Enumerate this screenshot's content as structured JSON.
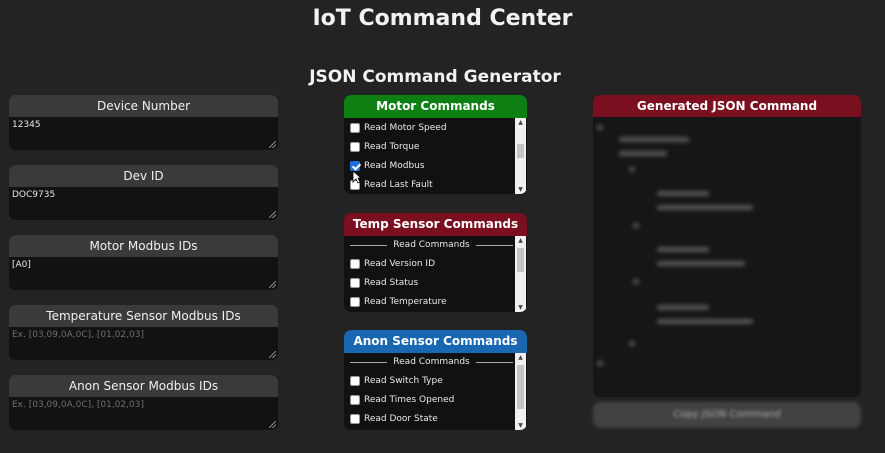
{
  "app": {
    "title": "IoT Command Center",
    "section_title": "JSON Command Generator"
  },
  "fields": [
    {
      "label": "Device Number",
      "value": "12345",
      "placeholder": ""
    },
    {
      "label": "Dev ID",
      "value": "DOC9735",
      "placeholder": ""
    },
    {
      "label": "Motor Modbus IDs",
      "value": "[A0]",
      "placeholder": ""
    },
    {
      "label": "Temperature Sensor Modbus IDs",
      "value": "",
      "placeholder": "Ex. [03,09,0A,0C], [01,02,03]"
    },
    {
      "label": "Anon Sensor Modbus IDs",
      "value": "",
      "placeholder": "Ex. [03,09,0A,0C], [01,02,03]"
    }
  ],
  "panels": {
    "motor": {
      "title": "Motor Commands",
      "color": "#0e7f12",
      "items": [
        {
          "label": "Read Motor Speed",
          "checked": false
        },
        {
          "label": "Read Torque",
          "checked": false
        },
        {
          "label": "Read Modbus",
          "checked": true
        },
        {
          "label": "Read Last Fault",
          "checked": false
        }
      ]
    },
    "temp": {
      "title": "Temp Sensor Commands",
      "color": "#7a0f1f",
      "group": "Read Commands",
      "items": [
        {
          "label": "Read Version ID",
          "checked": false
        },
        {
          "label": "Read Status",
          "checked": false
        },
        {
          "label": "Read Temperature",
          "checked": false
        }
      ]
    },
    "anon": {
      "title": "Anon Sensor Commands",
      "color": "#1867b0",
      "group": "Read Commands",
      "items": [
        {
          "label": "Read Switch Type",
          "checked": false
        },
        {
          "label": "Read Times Opened",
          "checked": false
        },
        {
          "label": "Read Door State",
          "checked": false
        }
      ]
    }
  },
  "json_output": {
    "title": "Generated JSON Command",
    "header_color": "#7a0f1f"
  },
  "copy_button": {
    "label": "Copy JSON Command"
  }
}
